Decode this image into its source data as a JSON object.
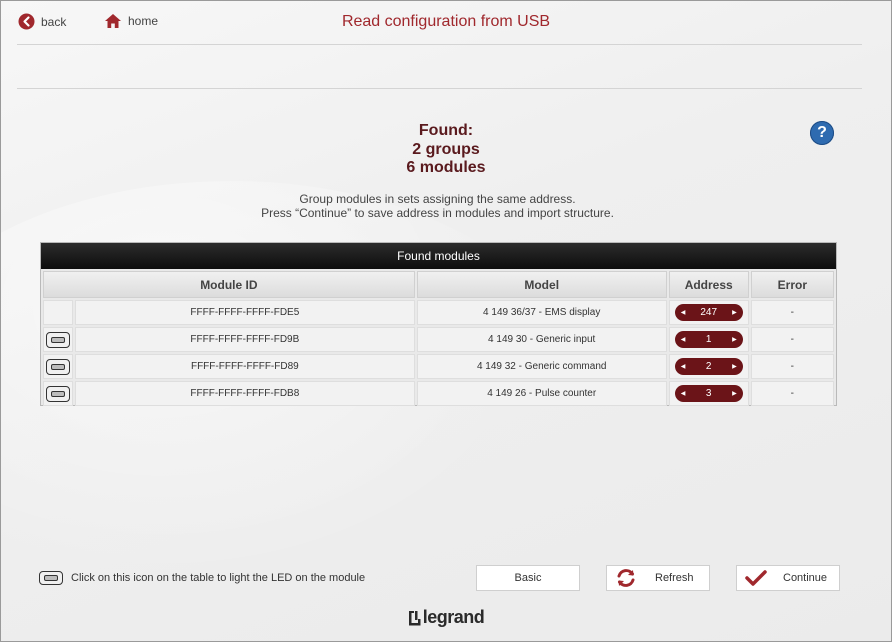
{
  "nav": {
    "back": "back",
    "home": "home"
  },
  "header": {
    "title": "Read configuration from USB"
  },
  "help": {
    "label": "?"
  },
  "summary": {
    "found": "Found:",
    "groups": "2 groups",
    "modules": "6 modules"
  },
  "instructions": {
    "line1": "Group modules in sets assigning the same address.",
    "line2": "Press “Continue” to save address in modules and import structure."
  },
  "table": {
    "title": "Found modules",
    "headers": [
      "Module ID",
      "Model",
      "Address",
      "Error"
    ],
    "rows": [
      {
        "id": "FFFF-FFFF-FFFF-FDE5",
        "model": "4 149 36/37 - EMS display",
        "address": "247",
        "error": "-",
        "led": false
      },
      {
        "id": "FFFF-FFFF-FFFF-FD9B",
        "model": "4 149 30 - Generic input",
        "address": "1",
        "error": "-",
        "led": true
      },
      {
        "id": "FFFF-FFFF-FFFF-FD89",
        "model": "4 149 32 - Generic command",
        "address": "2",
        "error": "-",
        "led": true
      },
      {
        "id": "FFFF-FFFF-FFFF-FDB8",
        "model": "4 149 26 - Pulse counter",
        "address": "3",
        "error": "-",
        "led": true
      }
    ]
  },
  "footer": {
    "note": "Click on this icon on the table to light the LED on the module",
    "basic": "Basic",
    "refresh": "Refresh",
    "continue": "Continue",
    "logo": "legrand"
  },
  "colors": {
    "accent": "#a0282d",
    "address_pill": "#6b1418",
    "help": "#2e6bb0"
  }
}
